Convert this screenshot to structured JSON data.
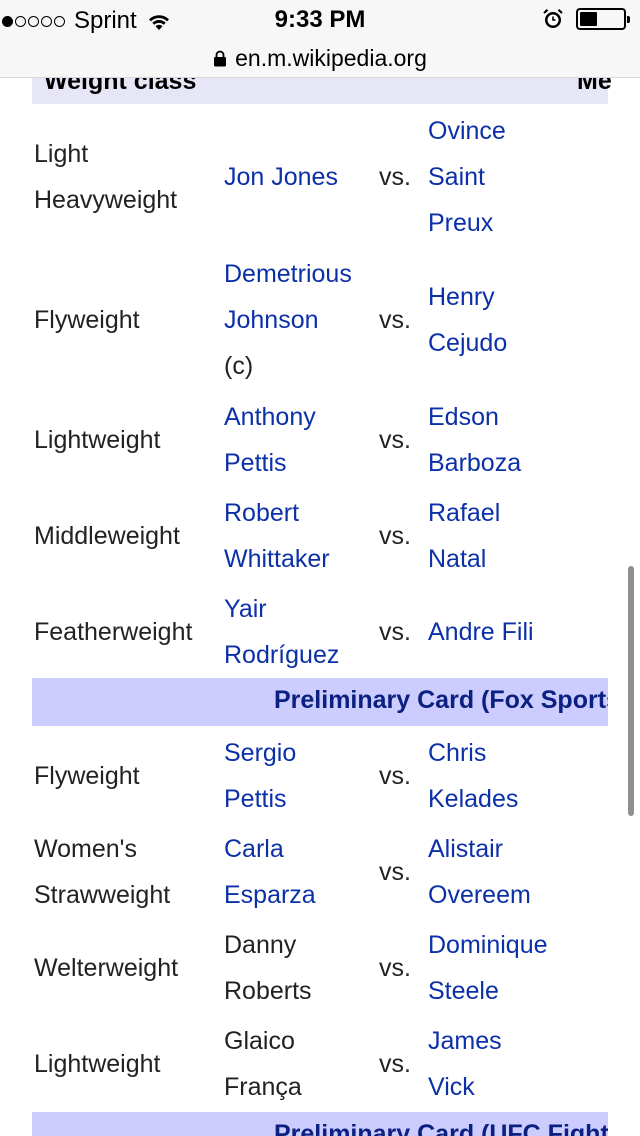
{
  "status_bar": {
    "carrier": "Sprint",
    "signal_strength": "1 of 5",
    "time": "9:33 PM",
    "battery_level": 0.4
  },
  "url_bar": {
    "domain": "en.m.wikipedia.org"
  },
  "table": {
    "header_left": "Weight class",
    "header_right": "Me",
    "rows": [
      {
        "weight_class": [
          "Light",
          "Heavyweight"
        ],
        "fighter1": [
          "Jon Jones"
        ],
        "fighter1_link": true,
        "vs": "vs.",
        "fighter2": [
          "Ovince",
          "Saint",
          "Preux"
        ]
      },
      {
        "weight_class": [
          "Flyweight"
        ],
        "fighter1": [
          "Demetrious",
          "Johnson"
        ],
        "fighter1_link": true,
        "fighter1_suffix": "(c)",
        "vs": "vs.",
        "fighter2": [
          "Henry",
          "Cejudo"
        ]
      },
      {
        "weight_class": [
          "Lightweight"
        ],
        "fighter1": [
          "Anthony",
          "Pettis"
        ],
        "fighter1_link": true,
        "vs": "vs.",
        "fighter2": [
          "Edson",
          "Barboza"
        ]
      },
      {
        "weight_class": [
          "Middleweight"
        ],
        "fighter1": [
          "Robert",
          "Whittaker"
        ],
        "fighter1_link": true,
        "vs": "vs.",
        "fighter2": [
          "Rafael",
          "Natal"
        ]
      },
      {
        "weight_class": [
          "Featherweight"
        ],
        "fighter1": [
          "Yair",
          "Rodríguez"
        ],
        "fighter1_link": true,
        "vs": "vs.",
        "fighter2": [
          "Andre Fili"
        ]
      }
    ],
    "section1": "Preliminary Card (Fox Sports",
    "rows2": [
      {
        "weight_class": [
          "Flyweight"
        ],
        "fighter1": [
          "Sergio",
          "Pettis"
        ],
        "fighter1_link": true,
        "vs": "vs.",
        "fighter2": [
          "Chris",
          "Kelades"
        ]
      },
      {
        "weight_class": [
          "Women's",
          "Strawweight"
        ],
        "fighter1": [
          "Carla",
          "Esparza"
        ],
        "fighter1_link": true,
        "vs": "vs.",
        "fighter2": [
          "Alistair",
          "Overeem"
        ]
      },
      {
        "weight_class": [
          "Welterweight"
        ],
        "fighter1": [
          "Danny",
          "Roberts"
        ],
        "fighter1_link": false,
        "vs": "vs.",
        "fighter2": [
          "Dominique",
          "Steele"
        ]
      },
      {
        "weight_class": [
          "Lightweight"
        ],
        "fighter1": [
          "Glaico",
          "França"
        ],
        "fighter1_link": false,
        "vs": "vs.",
        "fighter2": [
          "James",
          "Vick"
        ]
      }
    ],
    "section2": "Preliminary Card (UFC Fight"
  },
  "colors": {
    "link": "#0b30a8",
    "section_bg": "#ccccff",
    "header_bg": "#e6e6f7"
  }
}
